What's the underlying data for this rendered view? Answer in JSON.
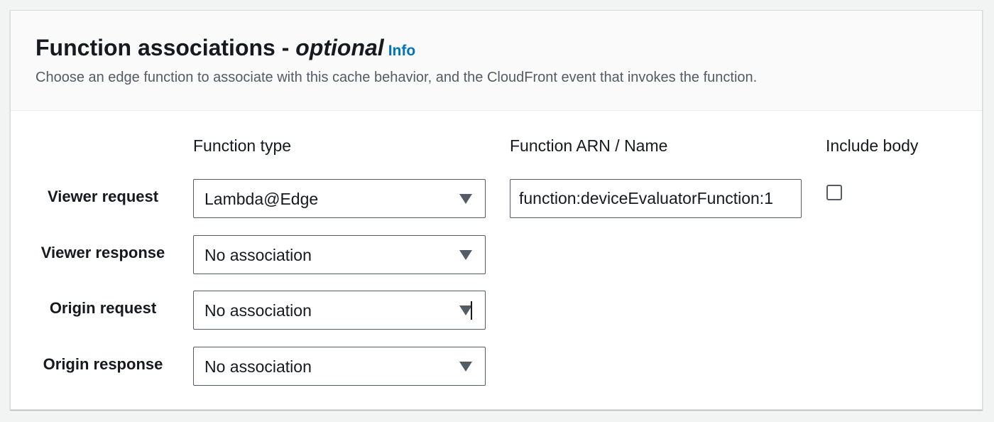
{
  "header": {
    "title": "Function associations",
    "title_separator": " - ",
    "title_optional": "optional",
    "info_link": "Info",
    "description": "Choose an edge function to associate with this cache behavior, and the CloudFront event that invokes the function."
  },
  "columns": {
    "function_type": "Function type",
    "function_arn": "Function ARN / Name",
    "include_body": "Include body"
  },
  "rows": [
    {
      "label": "Viewer request",
      "function_type": "Lambda@Edge",
      "function_arn": "function:deviceEvaluatorFunction:1",
      "include_body": false
    },
    {
      "label": "Viewer response",
      "function_type": "No association"
    },
    {
      "label": "Origin request",
      "function_type": "No association"
    },
    {
      "label": "Origin response",
      "function_type": "No association"
    }
  ],
  "colors": {
    "link": "#0073bb",
    "text": "#16191f",
    "secondary_text": "#545b64",
    "border": "#545b64",
    "header_bg": "#fafafa",
    "page_bg": "#f2f3f3"
  },
  "icons": {
    "dropdown": "caret-down-icon"
  }
}
